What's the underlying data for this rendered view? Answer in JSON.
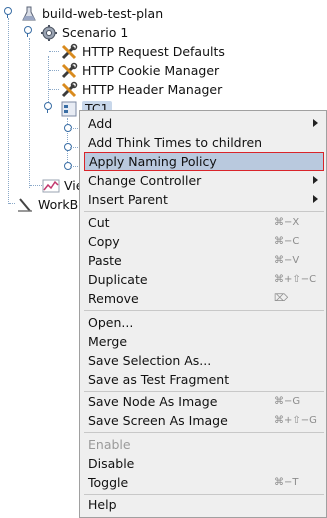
{
  "tree": {
    "root": {
      "label": "build-web-test-plan",
      "icon": "flask-icon"
    },
    "scenario": {
      "label": "Scenario 1",
      "icon": "gear-icon"
    },
    "items": [
      {
        "label": "HTTP Request Defaults",
        "icon": "wrench-screwdriver-icon"
      },
      {
        "label": "HTTP Cookie Manager",
        "icon": "wrench-screwdriver-icon"
      },
      {
        "label": "HTTP Header Manager",
        "icon": "wrench-screwdriver-icon"
      }
    ],
    "tc": {
      "label": "TC1",
      "icon": "transaction-controller-icon"
    },
    "viewer": {
      "label": "Vie",
      "icon": "graph-icon"
    },
    "workbench": {
      "label": "WorkBe",
      "icon": "workbench-icon"
    }
  },
  "menu": {
    "groups": [
      [
        {
          "label": "Add",
          "submenu": true
        },
        {
          "label": "Add Think Times to children"
        },
        {
          "label": "Apply Naming Policy",
          "highlighted": true
        },
        {
          "label": "Change Controller",
          "submenu": true
        },
        {
          "label": "Insert Parent",
          "submenu": true
        }
      ],
      [
        {
          "label": "Cut",
          "shortcut": "⌘−X"
        },
        {
          "label": "Copy",
          "shortcut": "⌘−C"
        },
        {
          "label": "Paste",
          "shortcut": "⌘−V"
        },
        {
          "label": "Duplicate",
          "shortcut": "⌘+⇧−C"
        },
        {
          "label": "Remove",
          "shortcut": "⌦"
        }
      ],
      [
        {
          "label": "Open..."
        },
        {
          "label": "Merge"
        },
        {
          "label": "Save Selection As..."
        },
        {
          "label": "Save as Test Fragment"
        }
      ],
      [
        {
          "label": "Save Node As Image",
          "shortcut": "⌘−G"
        },
        {
          "label": "Save Screen As Image",
          "shortcut": "⌘+⇧−G"
        }
      ],
      [
        {
          "label": "Enable",
          "disabled": true
        },
        {
          "label": "Disable"
        },
        {
          "label": "Toggle",
          "shortcut": "⌘−T"
        }
      ],
      [
        {
          "label": "Help"
        }
      ]
    ]
  },
  "colors": {
    "selection": "#c8d7ea",
    "menu_bg": "#efefef",
    "menu_highlight": "#b9c9de",
    "highlight_border": "#d9242a"
  }
}
